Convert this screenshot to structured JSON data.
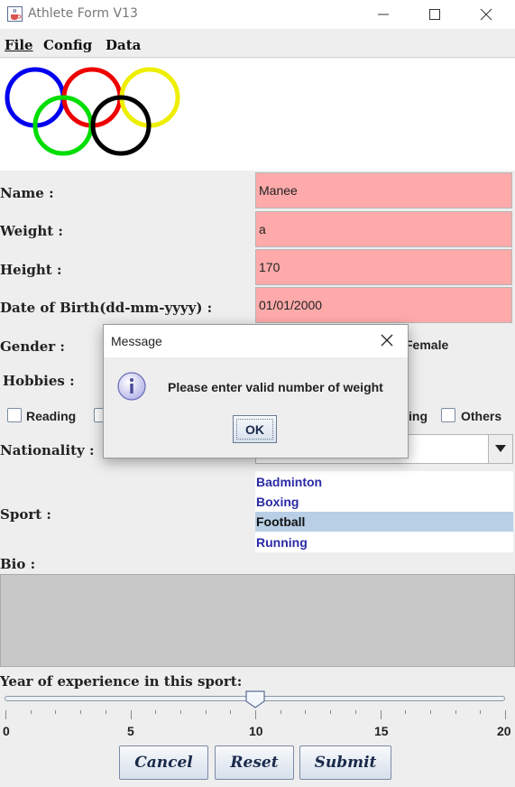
{
  "window": {
    "title": "Athlete Form V13",
    "icon": "java-cup-icon"
  },
  "menu": {
    "file": "File",
    "config": "Config",
    "data": "Data"
  },
  "logo": {
    "ring_colors": [
      "#0000ee",
      "#ee0000",
      "#eeee00",
      "#00dd00",
      "#000000"
    ]
  },
  "form": {
    "name_label": "Name :",
    "name_value": "Manee",
    "weight_label": "Weight :",
    "weight_value": "a",
    "height_label": "Height :",
    "height_value": "170",
    "dob_label": "Date of Birth(dd-mm-yyyy) :",
    "dob_value": "01/01/2000",
    "invalid_field_color": "#ffaaaa",
    "gender_label": "Gender :",
    "gender_female": "Female",
    "hobbies_label": "Hobbies :",
    "hobby_reading": "Reading",
    "hobby_partial": "ing",
    "hobby_others": "Others",
    "nationality_label": "Nationality :",
    "sport_label": "Sport :",
    "sports": [
      "Badminton",
      "Boxing",
      "Football",
      "Running"
    ],
    "selected_sport": "Football",
    "bio_label": "Bio :",
    "experience_label": "Year of experience in this sport:",
    "experience_value": 10,
    "experience_min": 0,
    "experience_max": 20,
    "tick_labels": [
      "0",
      "5",
      "10",
      "15",
      "20"
    ]
  },
  "buttons": {
    "cancel": "Cancel",
    "reset": "Reset",
    "submit": "Submit"
  },
  "dialog": {
    "title": "Message",
    "message": "Please enter valid number of weight",
    "ok": "OK",
    "icon": "info-icon"
  }
}
